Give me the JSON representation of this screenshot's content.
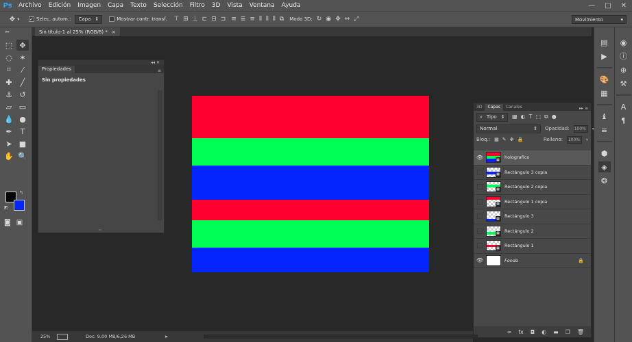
{
  "app": {
    "logo": "Ps"
  },
  "menu": [
    "Archivo",
    "Edición",
    "Imagen",
    "Capa",
    "Texto",
    "Selección",
    "Filtro",
    "3D",
    "Vista",
    "Ventana",
    "Ayuda"
  ],
  "window_controls": {
    "minimize": "—",
    "maximize": "□",
    "close": "✕"
  },
  "options": {
    "auto_select_label": "Selec. autom.:",
    "auto_select_value": "Capa",
    "show_transform_label": "Mostrar contr. transf.",
    "mode3d_label": "Modo 3D:",
    "workspace": "Movimiento"
  },
  "document_tab": {
    "title": "Sin título-1 al 25% (RGB/8) *",
    "close": "×"
  },
  "colors": {
    "foreground": "#000000",
    "background": "#0525ff",
    "red": "#ff0030",
    "green": "#00ff55",
    "blue": "#0525ff"
  },
  "properties_panel": {
    "tab": "Propiedades",
    "heading": "Sin propiedades",
    "collapse": "◂◂ ✕"
  },
  "canvas": {
    "stripes": [
      {
        "color": "#ff0030",
        "fraction": 0.24
      },
      {
        "color": "#00ff55",
        "fraction": 0.155
      },
      {
        "color": "#0525ff",
        "fraction": 0.195
      },
      {
        "color": "#ff0030",
        "fraction": 0.115
      },
      {
        "color": "#00ff55",
        "fraction": 0.155
      },
      {
        "color": "#0525ff",
        "fraction": 0.14
      }
    ]
  },
  "layers_panel": {
    "tabs": [
      "3D",
      "Capas",
      "Canales"
    ],
    "active_tab": "Capas",
    "filter_kind": "Tipo",
    "blend_mode": "Normal",
    "opacity_label": "Opacidad:",
    "opacity_value": "100%",
    "lock_label": "Bloq.:",
    "fill_label": "Relleno:",
    "fill_value": "100%",
    "layers": [
      {
        "name": "holografico",
        "visible": true,
        "selected": true,
        "thumb": "stack"
      },
      {
        "name": "Rectángulo 3 copia",
        "visible": false,
        "thumb": "blue"
      },
      {
        "name": "Rectángulo 2 copia",
        "visible": false,
        "thumb": "green"
      },
      {
        "name": "Rectángulo 1 copia",
        "visible": false,
        "thumb": "red"
      },
      {
        "name": "Rectángulo 3",
        "visible": false,
        "thumb": "blue-bottom"
      },
      {
        "name": "Rectángulo 2",
        "visible": false,
        "thumb": "green-bottom"
      },
      {
        "name": "Rectángulo 1",
        "visible": false,
        "thumb": "red-bottom"
      },
      {
        "name": "Fondo",
        "visible": true,
        "thumb": "white",
        "locked": true
      }
    ]
  },
  "status": {
    "zoom": "25%",
    "doc": "Doc: 9,00 MB/6,26 MB",
    "arrow": "▸"
  }
}
